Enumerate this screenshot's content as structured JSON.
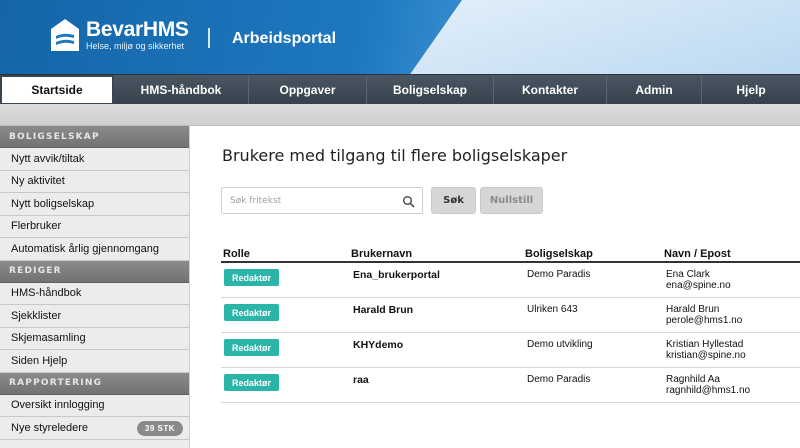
{
  "header": {
    "brand": "BevarHMS",
    "tagline": "Helse, miljø og sikkerhet",
    "portal": "Arbeidsportal"
  },
  "nav": {
    "items": [
      {
        "label": "Startside",
        "active": true
      },
      {
        "label": "HMS-håndbok"
      },
      {
        "label": "Oppgaver"
      },
      {
        "label": "Boligselskap"
      },
      {
        "label": "Kontakter"
      },
      {
        "label": "Admin"
      },
      {
        "label": "Hjelp"
      }
    ]
  },
  "sidebar": {
    "sections": [
      {
        "title": "BOLIGSELSKAP",
        "items": [
          "Nytt avvik/tiltak",
          "Ny aktivitet",
          "Nytt boligselskap",
          "Flerbruker",
          "Automatisk årlig gjennomgang"
        ]
      },
      {
        "title": "REDIGER",
        "items": [
          "HMS-håndbok",
          "Sjekklister",
          "Skjemasamling",
          "Siden Hjelp"
        ]
      },
      {
        "title": "RAPPORTERING",
        "items": [
          "Oversikt innlogging",
          "Nye styreledere"
        ]
      }
    ],
    "badge": "39 STK"
  },
  "main": {
    "title": "Brukere med tilgang til flere boligselskaper",
    "search_placeholder": "Søk fritekst",
    "search_button": "Søk",
    "reset_button": "Nullstill",
    "columns": [
      "Rolle",
      "Brukernavn",
      "Boligselskap",
      "Navn / Epost"
    ],
    "rows": [
      {
        "role": "Redaktør",
        "username": "Ena_brukerportal",
        "company": "Demo Paradis",
        "name": "Ena Clark",
        "email": "ena@spine.no"
      },
      {
        "role": "Redaktør",
        "username": "Harald Brun",
        "company": "Ulriken 643",
        "name": "Harald Brun",
        "email": "perole@hms1.no"
      },
      {
        "role": "Redaktør",
        "username": "KHYdemo",
        "company": "Demo utvikling",
        "name": "Kristian Hyllestad",
        "email": "kristian@spine.no"
      },
      {
        "role": "Redaktør",
        "username": "raa",
        "company": "Demo Paradis",
        "name": "Ragnhild Aa",
        "email": "ragnhild@hms1.no"
      }
    ]
  },
  "colors": {
    "accent": "#2bb5a8",
    "nav": "#3a4753",
    "header": "#1e78c0"
  }
}
